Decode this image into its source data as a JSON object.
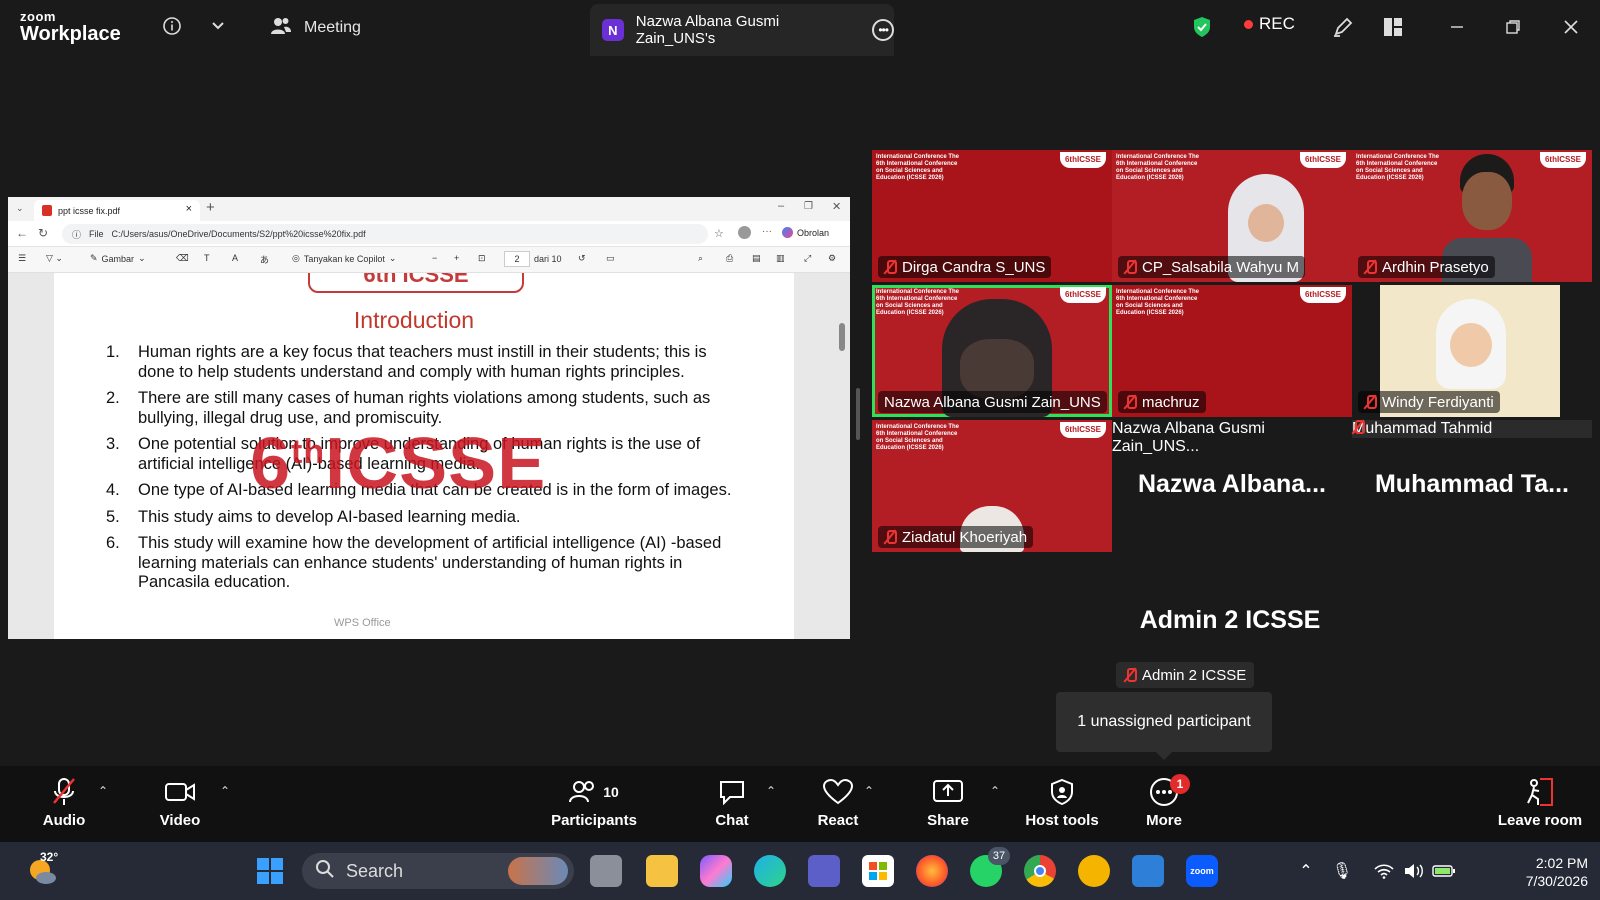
{
  "app": {
    "logo_line1": "zoom",
    "logo_line2": "Workplace",
    "meeting_tab": "Meeting",
    "active_tab_initial": "N",
    "active_tab_title": "Nazwa Albana Gusmi Zain_UNS's",
    "rec_label": "REC"
  },
  "browser": {
    "tab_title": "ppt icsse fix.pdf",
    "address_prefix": "File",
    "address": "C:/Users/asus/OneDrive/Documents/S2/ppt%20icsse%20fix.pdf",
    "copilot_label": "Obrolan",
    "tool_draw": "Gambar",
    "tool_ask": "Tanyakan ke Copilot",
    "page_current": "2",
    "page_total": "dari 10"
  },
  "slide": {
    "header": "6th ICSSE",
    "title": "Introduction",
    "items": [
      {
        "num": "1.",
        "text": "Human rights are a key focus that teachers must instill in their students; this is done to help students understand and comply with human rights principles."
      },
      {
        "num": "2.",
        "text": "There are still many cases of human rights violations among students, such as bullying, illegal drug use, and promiscuity."
      },
      {
        "num": "3.",
        "text": "One potential solution to improve understanding of human rights is the use of artificial intelligence (AI)-based learning media."
      },
      {
        "num": "4.",
        "text": "One type of AI-based learning media that can be created is in the form of images."
      },
      {
        "num": "5.",
        "text": "This study aims to develop AI-based learning media."
      },
      {
        "num": "6.",
        "text": "This study will examine how the development of artificial intelligence (AI) -based learning materials can enhance students' understanding of human rights in Pancasila education."
      }
    ],
    "watermark_main": "6",
    "watermark_sup": "th",
    "watermark_rest": "ICSSE",
    "footer": "WPS Office"
  },
  "tile_text": {
    "conference": "International Conference The 6th International Conference on Social Sciences and Education (ICSSE 2026)",
    "badge": "6thICSSE"
  },
  "participants": [
    {
      "name": "Dirga Candra S_UNS"
    },
    {
      "name": "CP_Salsabila Wahyu M"
    },
    {
      "name": "Ardhin Prasetyo"
    },
    {
      "name": "Nazwa Albana Gusmi Zain_UNS"
    },
    {
      "name": "machruz"
    },
    {
      "name": "Windy Ferdiyanti"
    },
    {
      "name": "Ziadatul Khoeriyah"
    },
    {
      "name": "Nazwa Albana Gusmi Zain_UNS...",
      "big": "Nazwa  Albana..."
    },
    {
      "name": "Muhammad Tahmid",
      "big": "Muhammad  Ta..."
    }
  ],
  "admin": {
    "big": "Admin 2 ICSSE",
    "label": "Admin 2 ICSSE"
  },
  "tooltip": "1 unassigned participant",
  "toolbar": {
    "audio": "Audio",
    "video": "Video",
    "participants": "Participants",
    "participants_count": "10",
    "chat": "Chat",
    "react": "React",
    "share": "Share",
    "host_tools": "Host tools",
    "more": "More",
    "more_badge": "1",
    "leave": "Leave room"
  },
  "taskbar": {
    "temperature": "32°",
    "search_placeholder": "Search",
    "whatsapp_badge": "37",
    "time": "2:02 PM",
    "date": "7/30/2026"
  },
  "colors": {
    "tile_red": "#b31d24",
    "active_speaker": "#2ee05a",
    "rec_dot": "#ff3b3b",
    "shield_green": "#22c55e"
  }
}
